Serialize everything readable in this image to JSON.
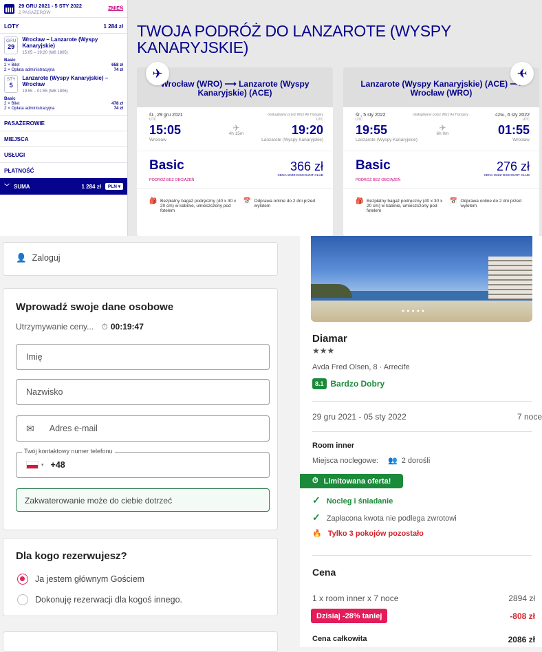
{
  "wizz": {
    "dates": "29 GRU 2021 - 5 STY 2022",
    "passengers": "2 PASAŻERÓW",
    "change": "ZMIEŃ",
    "flights_label": "LOTY",
    "flights_total": "1 284 zł",
    "leg1": {
      "month": "GRU",
      "day": "29",
      "route": "Wrocław – Lanzarote (Wyspy Kanaryjskie)",
      "times": "15:05 – 19:20 (W6 1805)",
      "fare": "Basic",
      "ticket": "2 × Bilet",
      "ticket_price": "658 zł",
      "admin": "2 × Opłata administracyjna",
      "admin_price": "74 zł"
    },
    "leg2": {
      "month": "STY",
      "day": "5",
      "route": "Lanzarote (Wyspy Kanaryjskie) – Wrocław",
      "times": "19:55 – 01:55 (W6 1806)",
      "fare": "Basic",
      "ticket": "2 × Bilet",
      "ticket_price": "478 zł",
      "admin": "2 × Opłata administracyjna",
      "admin_price": "74 zł"
    },
    "sections": [
      "PASAŻEROWIE",
      "MIEJSCA",
      "USŁUGI",
      "PŁATNOŚĆ"
    ],
    "sum_label": "SUMA",
    "sum_value": "1 284 zł",
    "currency": "PLN",
    "title": "TWOJA PODRÓŻ DO LANZAROTE (WYSPY KANARYJSKIE)",
    "out": {
      "header": "Wrocław (WRO) ⟶ Lanzarote (Wyspy Kanaryjskie) (ACE)",
      "date": "śr., 29 gru 2021",
      "operated": "obsługiwany przez Wizz Air Hungary",
      "utc1": "UTC",
      "utc2": "UTC",
      "dep": "15:05",
      "arr": "19:20",
      "duration": "4h 15m",
      "from": "Wrocław",
      "to": "Lanzarote (Wyspy Kanaryjskie)",
      "fare": "Basic",
      "fare_sub": "PODRÓŻ BEZ OBCIĄŻEŃ",
      "price": "366 zł",
      "club": "CENA WIZZ DISCOUNT CLUB"
    },
    "ret": {
      "header": "Lanzarote (Wyspy Kanaryjskie) (ACE) ⟶ Wrocław (WRO)",
      "date": "śr., 5 sty 2022",
      "operated": "obsługiwany przez Wizz Air Hungary",
      "date2": "czw., 6 sty 2022",
      "utc1": "UTC",
      "utc2": "UTC",
      "dep": "19:55",
      "arr": "01:55",
      "duration": "6h 0m",
      "from": "Lanzarote (Wyspy Kanaryjskie)",
      "to": "Wrocław",
      "fare": "Basic",
      "fare_sub": "PODRÓŻ BEZ OBCIĄŻEŃ",
      "price": "276 zł",
      "club": "CENA WIZZ DISCOUNT CLUB"
    },
    "perk_bag": "Bezpłatny bagaż podręczny (40 x 30 x 20 cm) w kabinie, umieszczony pod fotelem",
    "perk_checkin": "Odprawa online do 2 dni przed wylotem"
  },
  "booking": {
    "login": "Zaloguj",
    "form_title": "Wprowadź swoje dane osobowe",
    "hold_label": "Utrzymywanie ceny...",
    "timer": "00:19:47",
    "first_name": "Imię",
    "last_name": "Nazwisko",
    "email": "Adres e-mail",
    "phone_label": "Twój kontaktowy numer telefonu",
    "phone_prefix": "+48",
    "contact_note": "Zakwaterowanie może do ciebie dotrzeć",
    "who_title": "Dla kogo rezerwujesz?",
    "opt1": "Ja jestem głównym Gościem",
    "opt2": "Dokonuję rezerwacji dla kogoś innego."
  },
  "hotel": {
    "name": "Diamar",
    "stars": "★★★",
    "address": "Avda Fred Olsen, 8 · Arrecife",
    "score": "8.1",
    "score_label": "Bardzo Dobry",
    "dates": "29 gru 2021 - 05 sty 2022",
    "nights": "7 noce",
    "room": "Room inner",
    "sleeps_label": "Miejsca noclegowe:",
    "sleeps": "2 dorośli",
    "offer_badge": "Limitowana oferta!",
    "feat1": "Nocleg i śniadanie",
    "feat2": "Zapłacona kwota nie podlega zwrotowi",
    "rooms_left": "Tylko 3 pokojów pozostało",
    "price_title": "Cena",
    "line_label": "1 x room inner x 7 noce",
    "line_price": "2894 zł",
    "discount_label": "Dzisiaj -28% taniej",
    "discount_value": "-808 zł",
    "total_label": "Cena całkowita",
    "total_value": "2086 zł"
  }
}
